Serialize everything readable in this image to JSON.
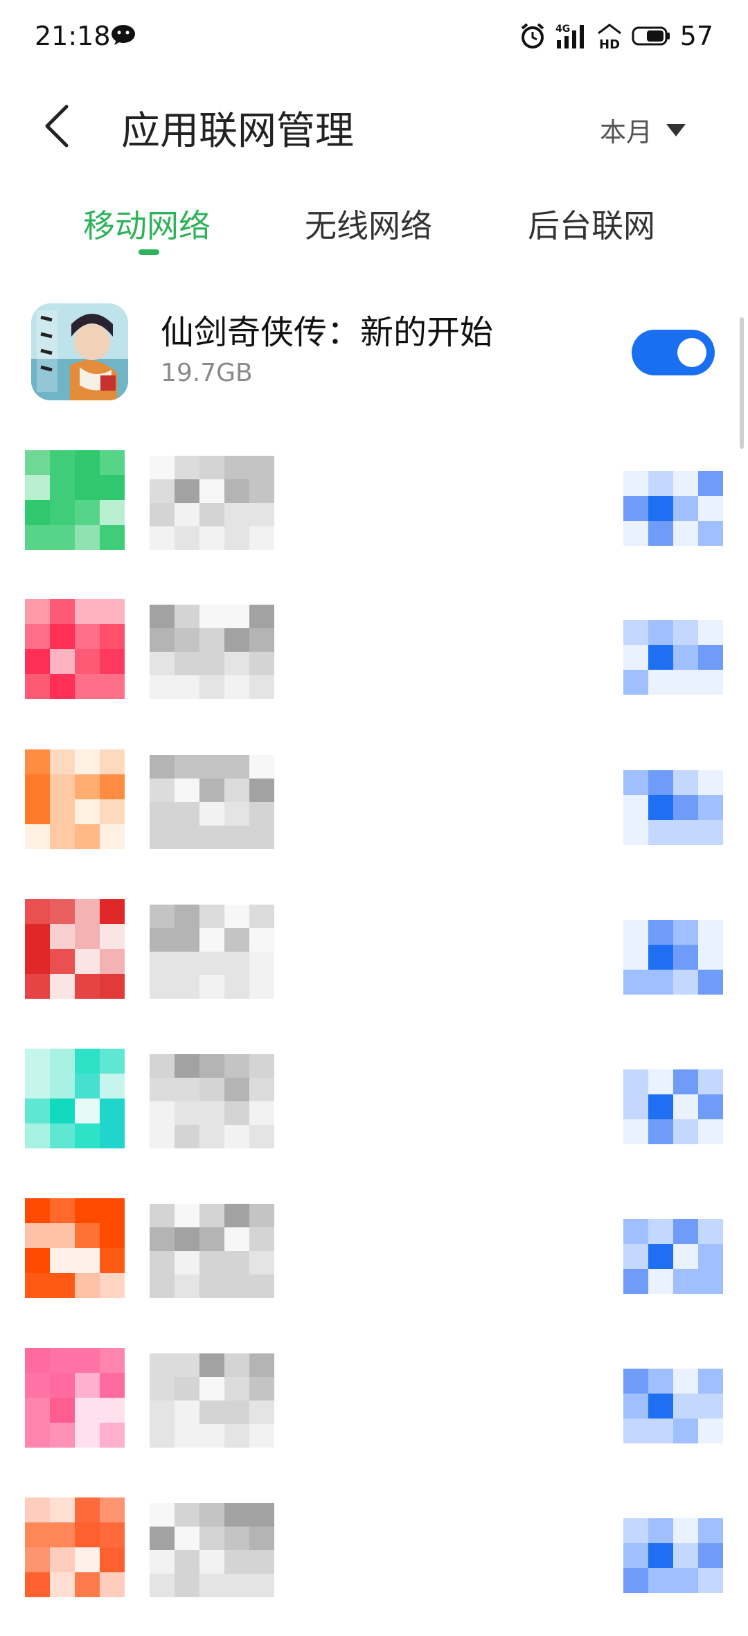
{
  "status_bar": {
    "time": "21:18",
    "battery_level": "57",
    "icons": [
      "wechat-icon",
      "alarm-icon",
      "4g-signal-icon",
      "hd-icon",
      "battery-icon"
    ]
  },
  "header": {
    "title": "应用联网管理",
    "period": "本月"
  },
  "tabs": [
    {
      "label": "移动网络",
      "active": true
    },
    {
      "label": "无线网络",
      "active": false
    },
    {
      "label": "后台联网",
      "active": false
    }
  ],
  "apps": [
    {
      "name": "仙剑奇侠传：新的开始",
      "usage": "19.7GB",
      "enabled": true
    }
  ],
  "colors": {
    "accent_green": "#2eb35a",
    "toggle_blue": "#1a6ef0"
  }
}
